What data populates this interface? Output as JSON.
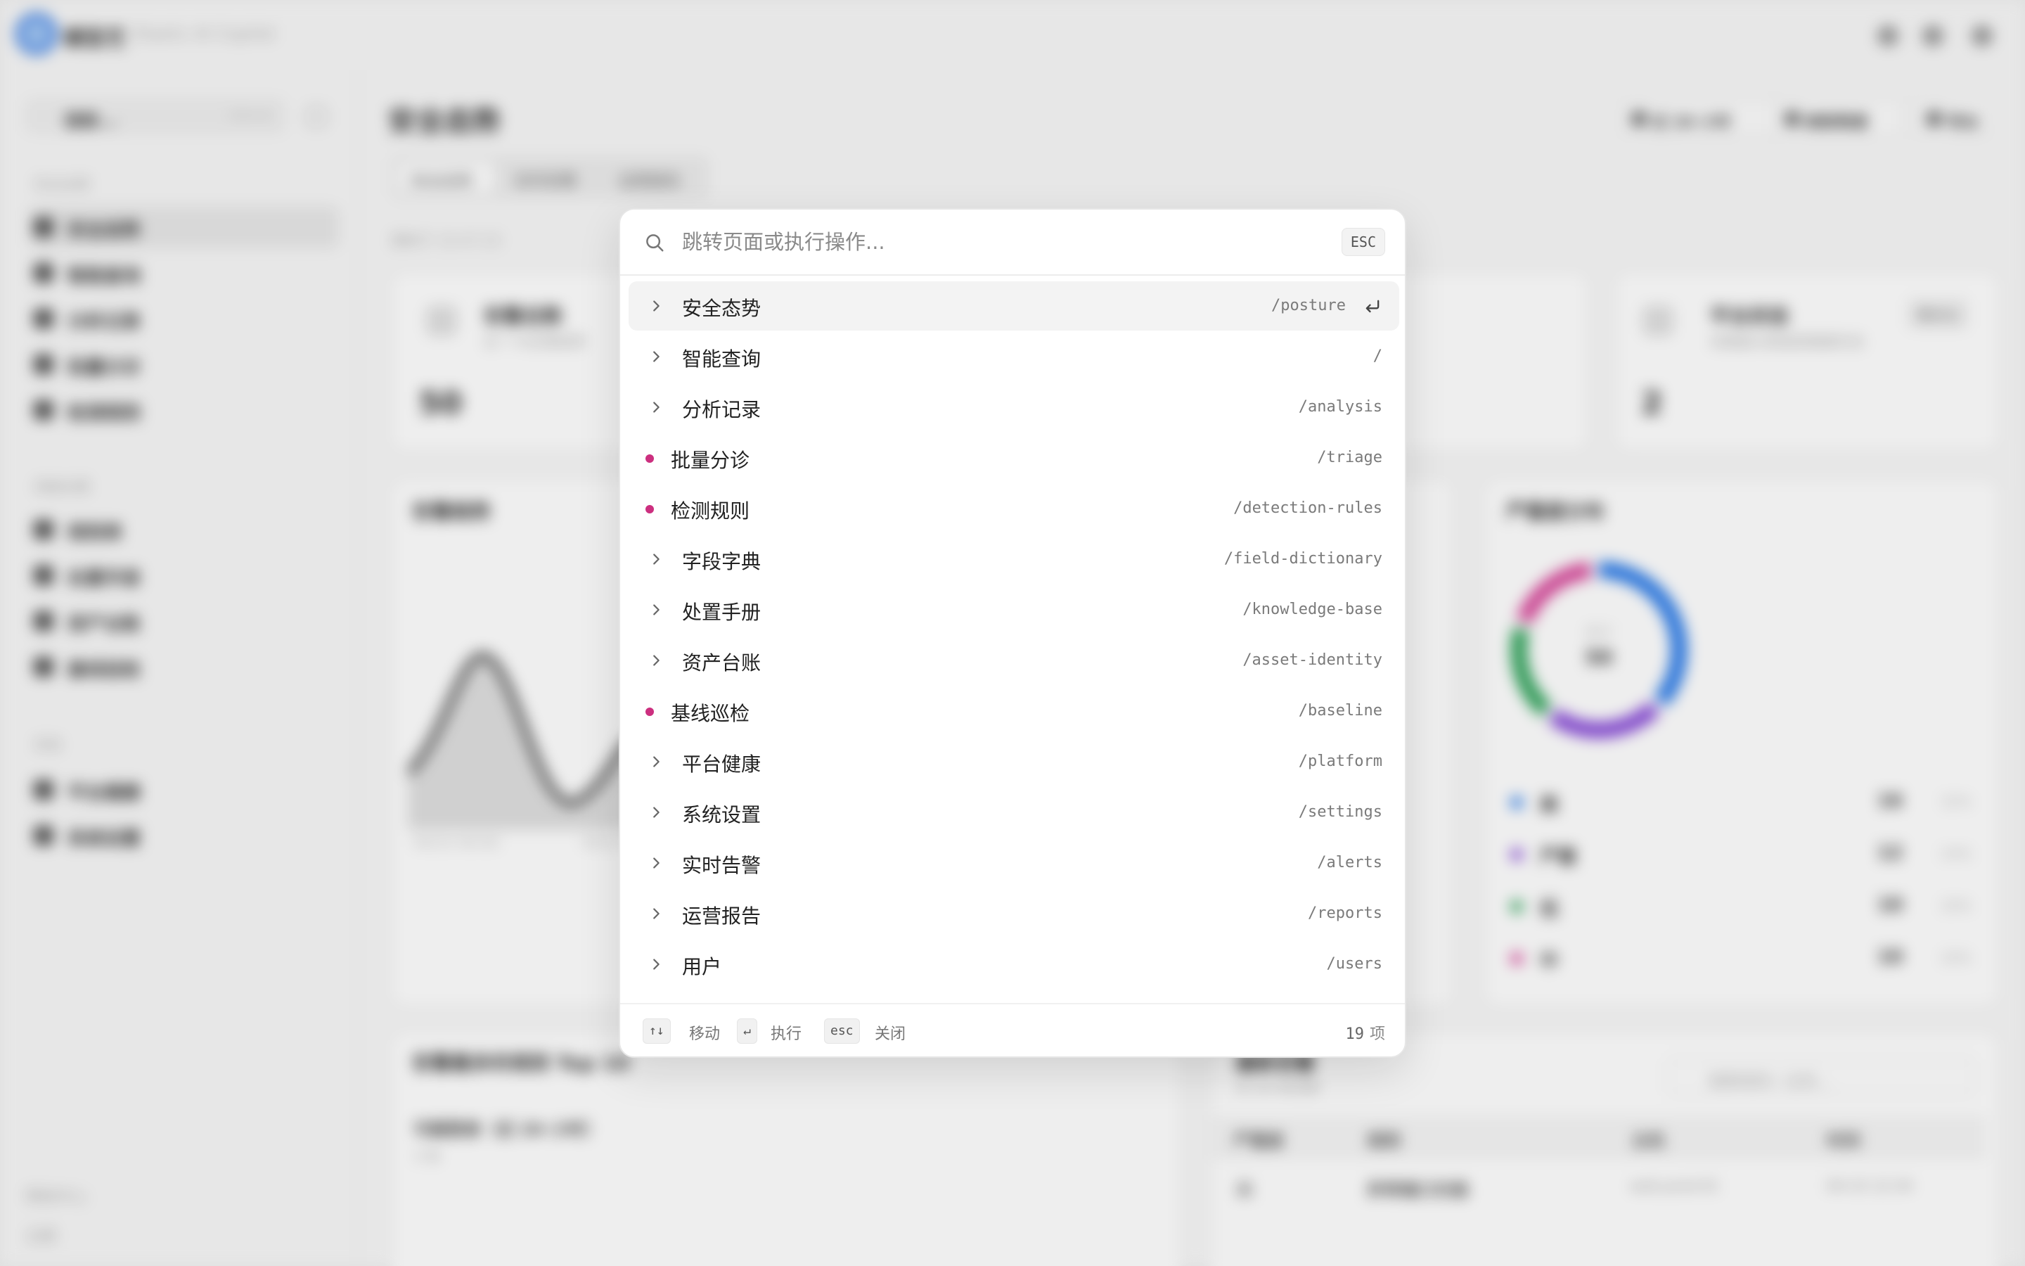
{
  "background": {
    "brand_name": "模型艺",
    "brand_sub": "Elastic AI Copilot",
    "sidebar": {
      "search_label": "搜索...",
      "search_shortcut": "Ctrl+K",
      "groups": [
        "安全运营",
        "调查处置",
        "系统"
      ],
      "items": [
        {
          "label": "安全态势",
          "active": true
        },
        {
          "label": "智能查询"
        },
        {
          "label": "分析记录"
        },
        {
          "label": "批量分诊"
        },
        {
          "label": "检测规则"
        },
        {
          "label": "规则库"
        },
        {
          "label": "处置手册"
        },
        {
          "label": "资产台账"
        },
        {
          "label": "基线巡检"
        },
        {
          "label": "平台健康"
        },
        {
          "label": "系统设置"
        }
      ],
      "footer": [
        "帮助中心",
        "主题"
      ]
    },
    "page_title": "安全态势",
    "tabs": [
      "安全态势",
      "实时告警",
      "运营报告"
    ],
    "top_buttons": [
      "近 24 小时",
      "刷新数据",
      "导出"
    ],
    "updated_text": "更新于 15:47:23",
    "cards": {
      "events_title": "告警总数",
      "events_sub": "近 7 天告警趋势",
      "events_value": "50",
      "platform_title": "平台状态",
      "platform_sub": "采集器与数据源健康状态",
      "platform_value": "2",
      "platform_badge": "需关注",
      "trend_title": "告警趋势",
      "severity_title": "严重度分布",
      "severity_total": "50",
      "severity_total_label": "总计",
      "top_title": "告警最多的规则 Top 10",
      "top_row_1": "可疑登录（近 24 小时）",
      "top_row_1_sub": "3 条",
      "recent_title": "最新告警",
      "recent_sub": "共 50 条告警",
      "recent_search": "搜索规则 / 主机..."
    },
    "chart_axis": [
      "04/15 00:00",
      "04/15"
    ],
    "legend": [
      {
        "name": "高",
        "value": "16",
        "pct": "32%",
        "color": "#2d7be5"
      },
      {
        "name": "严重",
        "value": "12",
        "pct": "24%",
        "color": "#8a4fd6"
      },
      {
        "name": "低",
        "value": "10",
        "pct": "20%",
        "color": "#34a35d"
      },
      {
        "name": "中",
        "value": "10",
        "pct": "20%",
        "color": "#d64b9b"
      }
    ],
    "table_headers": [
      "严重度",
      "规则",
      "主机",
      "时间"
    ],
    "table_row": [
      "高",
      "异常端口扫描",
      "web-prod-01",
      "04-15 12:34"
    ]
  },
  "palette": {
    "placeholder": "跳转页面或执行操作...",
    "esc_label": "ESC",
    "items": [
      {
        "label": "安全态势",
        "path": "/posture",
        "marker": "chevron",
        "selected": true
      },
      {
        "label": "智能查询",
        "path": "/",
        "marker": "chevron"
      },
      {
        "label": "分析记录",
        "path": "/analysis",
        "marker": "chevron"
      },
      {
        "label": "批量分诊",
        "path": "/triage",
        "marker": "dot"
      },
      {
        "label": "检测规则",
        "path": "/detection-rules",
        "marker": "dot"
      },
      {
        "label": "字段字典",
        "path": "/field-dictionary",
        "marker": "chevron"
      },
      {
        "label": "处置手册",
        "path": "/knowledge-base",
        "marker": "chevron"
      },
      {
        "label": "资产台账",
        "path": "/asset-identity",
        "marker": "chevron"
      },
      {
        "label": "基线巡检",
        "path": "/baseline",
        "marker": "dot"
      },
      {
        "label": "平台健康",
        "path": "/platform",
        "marker": "chevron"
      },
      {
        "label": "系统设置",
        "path": "/settings",
        "marker": "chevron"
      },
      {
        "label": "实时告警",
        "path": "/alerts",
        "marker": "chevron"
      },
      {
        "label": "运营报告",
        "path": "/reports",
        "marker": "chevron"
      },
      {
        "label": "用户",
        "path": "/users",
        "marker": "chevron"
      }
    ],
    "footer": {
      "move_key": "↑↓",
      "move_label": "移动",
      "exec_key": "↵",
      "exec_label": "执行",
      "close_key": "esc",
      "close_label": "关闭",
      "count_value": "19",
      "count_unit": "项"
    },
    "accent_dot_color": "#cc2f7f"
  }
}
